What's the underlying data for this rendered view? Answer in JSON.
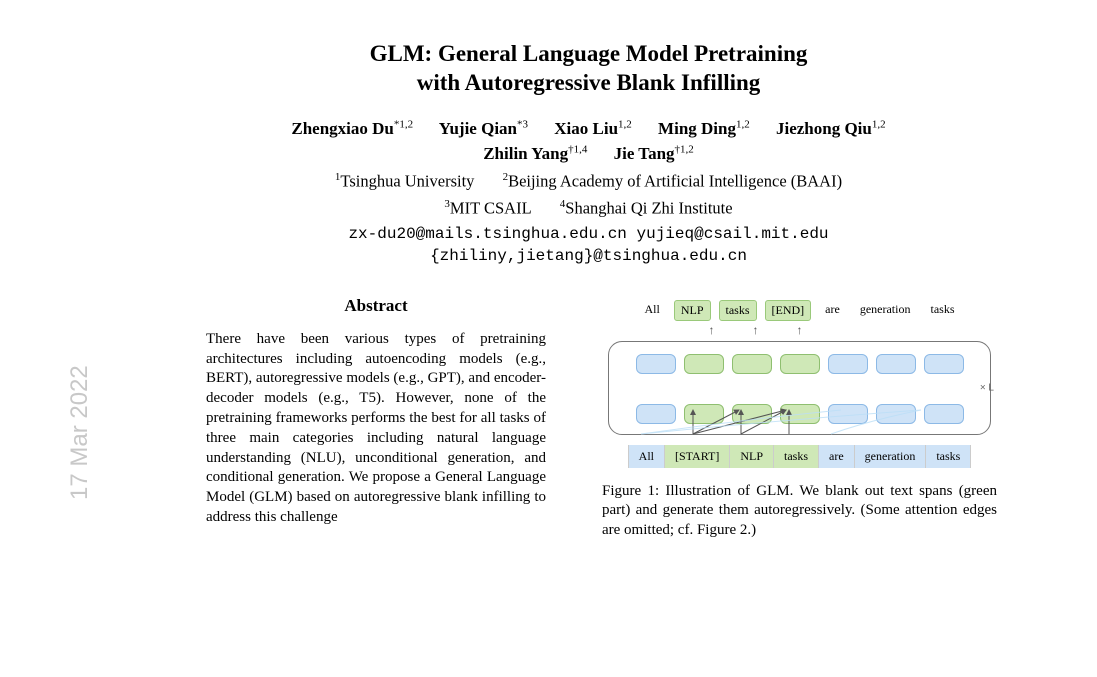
{
  "title_line1": "GLM: General Language Model Pretraining",
  "title_line2": "with Autoregressive Blank Infilling",
  "authors_row1": [
    {
      "name": "Zhengxiao Du",
      "mark": "*1,2"
    },
    {
      "name": "Yujie Qian",
      "mark": "*3"
    },
    {
      "name": "Xiao Liu",
      "mark": "1,2"
    },
    {
      "name": "Ming Ding",
      "mark": "1,2"
    },
    {
      "name": "Jiezhong Qiu",
      "mark": "1,2"
    }
  ],
  "authors_row2": [
    {
      "name": "Zhilin Yang",
      "mark": "†1,4"
    },
    {
      "name": "Jie Tang",
      "mark": "†1,2"
    }
  ],
  "affiliations_row1": [
    {
      "num": "1",
      "text": "Tsinghua University"
    },
    {
      "num": "2",
      "text": "Beijing Academy of Artificial Intelligence (BAAI)"
    }
  ],
  "affiliations_row2": [
    {
      "num": "3",
      "text": "MIT CSAIL"
    },
    {
      "num": "4",
      "text": "Shanghai Qi Zhi Institute"
    }
  ],
  "email1": "zx-du20@mails.tsinghua.edu.cn  yujieq@csail.mit.edu",
  "email2": "{zhiliny,jietang}@tsinghua.edu.cn",
  "abstract_heading": "Abstract",
  "abstract_body": "There have been various types of pretraining architectures including autoencoding models (e.g., BERT), autoregressive models (e.g., GPT), and encoder-decoder models (e.g., T5). However, none of the pretraining frameworks performs the best for all tasks of three main categories including natural language understanding (NLU), unconditional generation, and conditional generation. We propose a General Language Model (GLM) based on autoregressive blank infilling to address this challenge",
  "side_date": "17 Mar 2022",
  "figure": {
    "top_tokens": [
      "All",
      "NLP",
      "tasks",
      "[END]",
      "are",
      "generation",
      "tasks"
    ],
    "top_green_idx": [
      1,
      2,
      3
    ],
    "up_arrow_idx": [
      1,
      2,
      3
    ],
    "bottom_tokens": [
      "All",
      "[START]",
      "NLP",
      "tasks",
      "are",
      "generation",
      "tasks"
    ],
    "bottom_green_idx": [
      1,
      2,
      3
    ],
    "layer_label": "× L",
    "caption": "Figure 1: Illustration of GLM. We blank out text spans (green part) and generate them autoregressively. (Some attention edges are omitted; cf. Figure 2.)"
  }
}
